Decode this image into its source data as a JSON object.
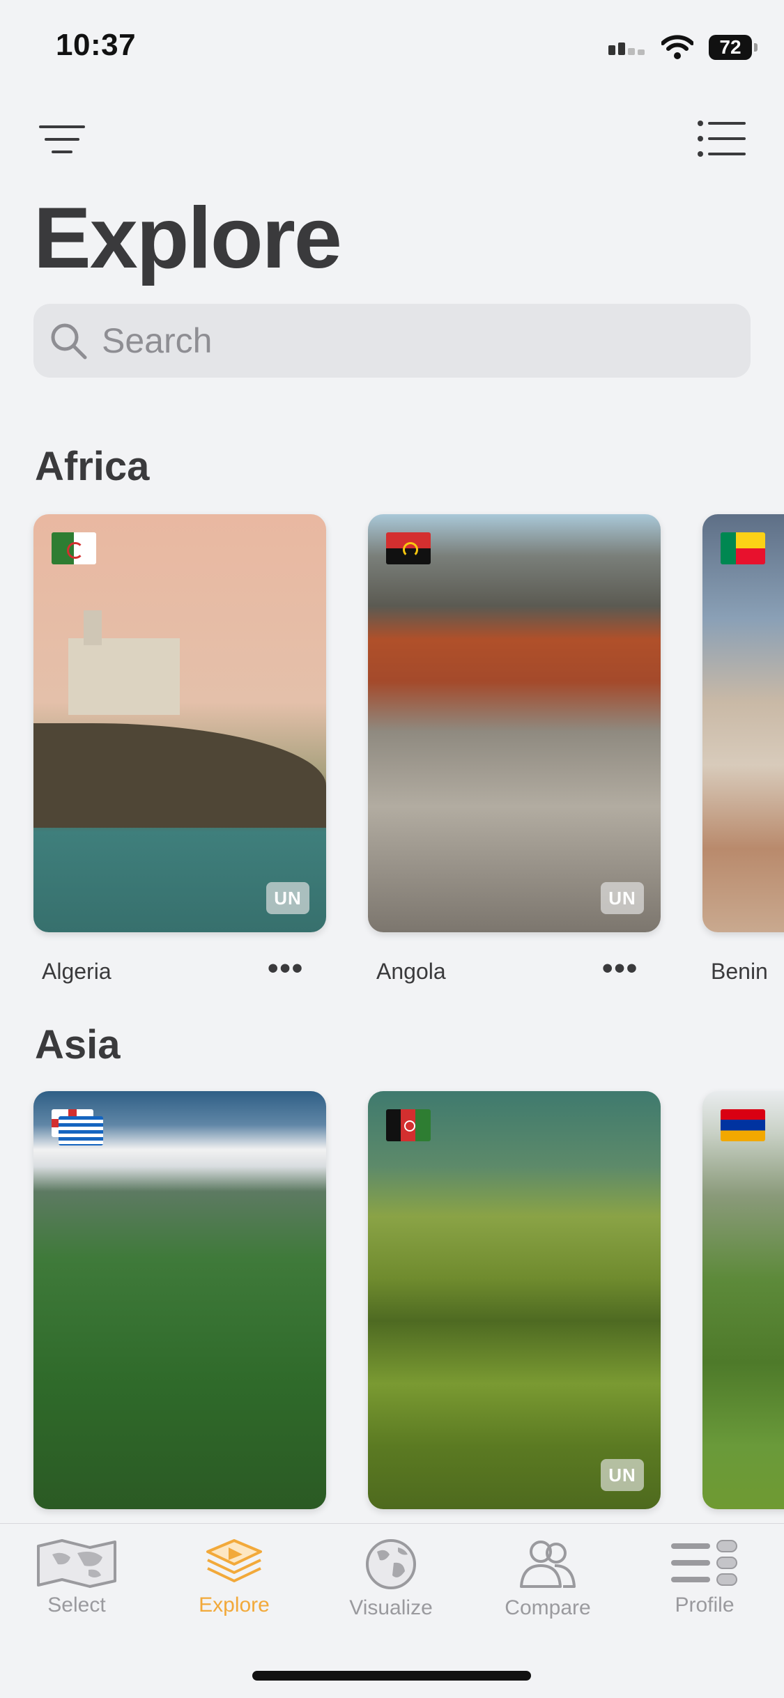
{
  "status": {
    "time": "10:37",
    "battery": "72"
  },
  "header": {
    "title": "Explore"
  },
  "search": {
    "placeholder": "Search"
  },
  "sections": [
    {
      "title": "Africa",
      "cards": [
        {
          "name": "Algeria",
          "badge": "UN"
        },
        {
          "name": "Angola",
          "badge": "UN"
        },
        {
          "name": "Benin"
        }
      ]
    },
    {
      "title": "Asia",
      "cards": [
        {
          "name": "",
          "badge": ""
        },
        {
          "name": "",
          "badge": "UN"
        },
        {
          "name": ""
        }
      ]
    }
  ],
  "tabs": [
    {
      "label": "Select",
      "icon": "map-icon"
    },
    {
      "label": "Explore",
      "icon": "layers-icon",
      "active": true
    },
    {
      "label": "Visualize",
      "icon": "globe-icon"
    },
    {
      "label": "Compare",
      "icon": "people-icon"
    },
    {
      "label": "Profile",
      "icon": "list-toggle-icon"
    }
  ],
  "colors": {
    "accent": "#f2a93a",
    "background": "#f2f3f5"
  }
}
